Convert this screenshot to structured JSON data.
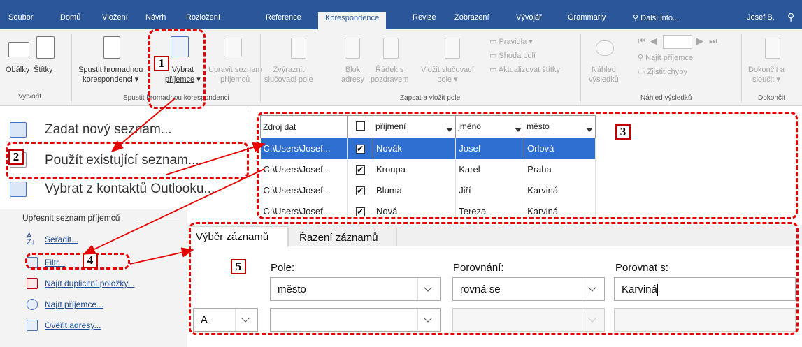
{
  "tabs": [
    "Soubor",
    "Domů",
    "Vložení",
    "Návrh",
    "Rozložení",
    "Reference",
    "Korespondence",
    "Revize",
    "Zobrazení",
    "Vývojář",
    "Grammarly"
  ],
  "active_tab": "Korespondence",
  "tell_me": "Další info...",
  "user": "Josef B.",
  "ribbon": {
    "vytvorit": {
      "obalky": "Obálky",
      "stitky": "Štítky",
      "group": "Vytvořit"
    },
    "hromadna": {
      "spustit_1": "Spustit hromadnou",
      "spustit_2": "korespondenci",
      "vybrat_1": "Vybrat",
      "vybrat_2": "příjemce",
      "upravit_1": "Upravit seznam",
      "upravit_2": "příjemců",
      "group": "Spustit hromadnou korespondenci"
    },
    "vlozit": {
      "zvyraznit_1": "Zvýraznit",
      "zvyraznit_2": "slučovací pole",
      "blok_1": "Blok",
      "blok_2": "adresy",
      "radek_1": "Řádek s",
      "radek_2": "pozdravem",
      "vlozit_1": "Vložit slučovací",
      "vlozit_2": "pole",
      "pravidla": "Pravidla",
      "shoda": "Shoda polí",
      "aktualizovat": "Aktualizovat štítky",
      "group": "Zapsat a vložit pole"
    },
    "nahled": {
      "nahled_1": "Náhled",
      "nahled_2": "výsledků",
      "najit": "Najít příjemce",
      "zjistit": "Zjistit chyby",
      "group": "Náhled výsledků"
    },
    "dokoncit": {
      "label_1": "Dokončit a",
      "label_2": "sloučit",
      "group": "Dokončit"
    }
  },
  "dropdown_menu": [
    "Zadat nový seznam...",
    "Použít existující seznam...",
    "Vybrat z kontaktů Outlooku..."
  ],
  "refine": {
    "title": "Upřesnit seznam příjemců",
    "links": [
      "Seřadit...",
      "Filtr...",
      "Najít duplicitní položky...",
      "Najít příjemce...",
      "Ověřit adresy..."
    ]
  },
  "table": {
    "headers": [
      "Zdroj dat",
      "",
      "příjmení",
      "jméno",
      "město"
    ],
    "rows": [
      {
        "source": "C:\\Users\\Josef...",
        "checked": "✔",
        "prijmeni": "Novák",
        "jmeno": "Josef",
        "mesto": "Orlová"
      },
      {
        "source": "C:\\Users\\Josef...",
        "checked": "✔",
        "prijmeni": "Kroupa",
        "jmeno": "Karel",
        "mesto": "Praha"
      },
      {
        "source": "C:\\Users\\Josef...",
        "checked": "✔",
        "prijmeni": "Bluma",
        "jmeno": "Jiří",
        "mesto": "Karviná"
      },
      {
        "source": "C:\\Users\\Josef...",
        "checked": "✔",
        "prijmeni": "Nová",
        "jmeno": "Tereza",
        "mesto": "Karviná"
      }
    ]
  },
  "filter_dialog": {
    "tabs": [
      "Výběr záznamů",
      "Řazení záznamů"
    ],
    "pole_label": "Pole:",
    "porovnani_label": "Porovnání:",
    "porovnat_label": "Porovnat s:",
    "row1": {
      "pole": "město",
      "porovnani": "rovná se",
      "hodnota": "Karviná"
    },
    "row2": {
      "spojka": "A"
    }
  },
  "annotations": [
    "1",
    "2",
    "3",
    "4",
    "5"
  ]
}
